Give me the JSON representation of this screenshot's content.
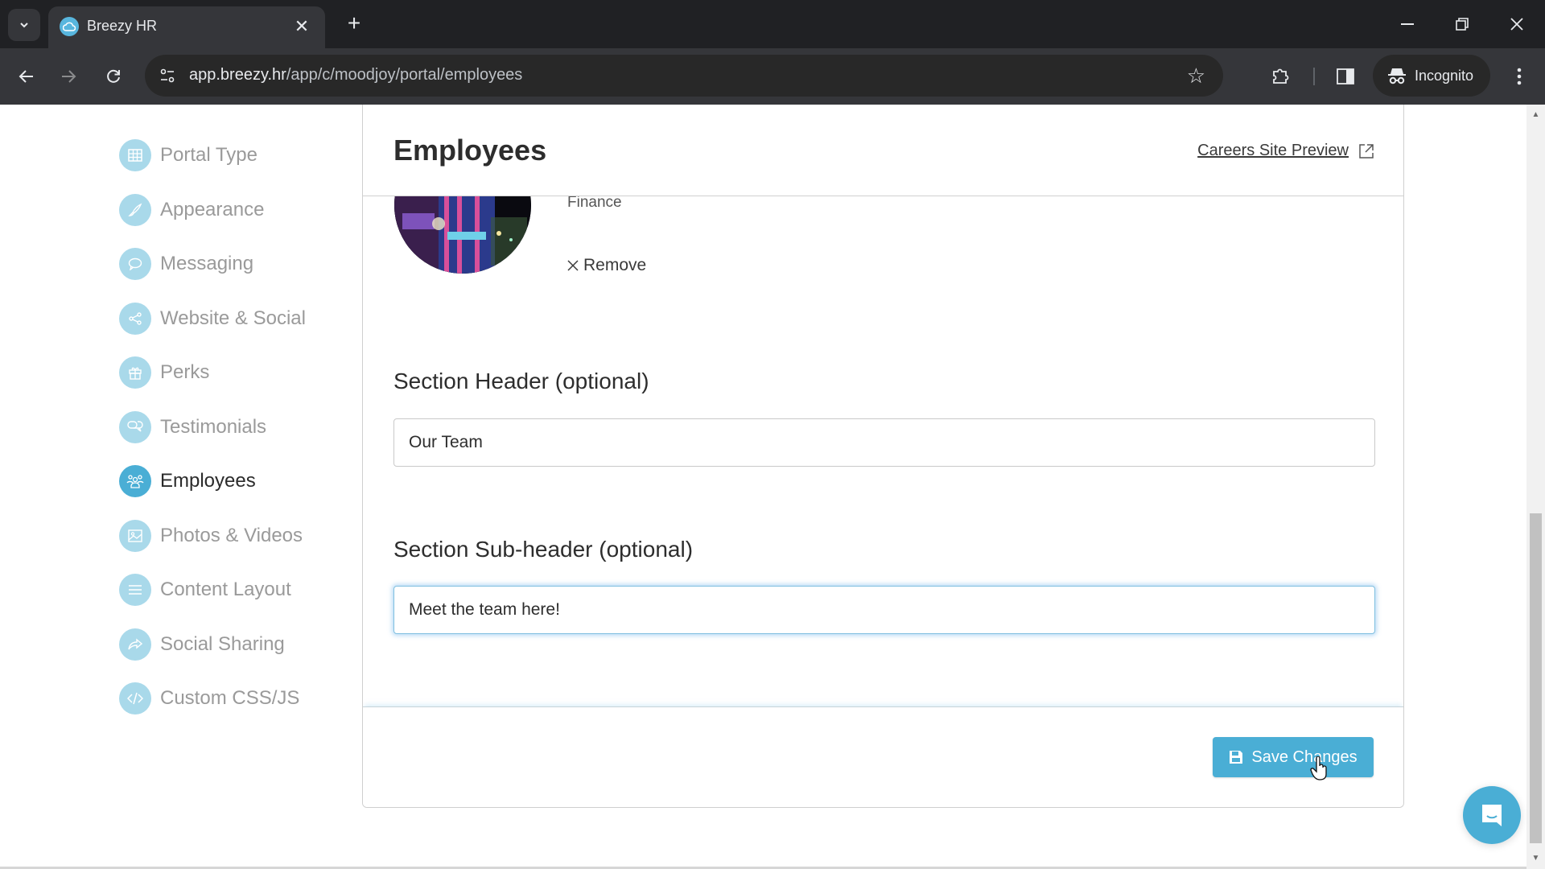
{
  "browser": {
    "tab_title": "Breezy HR",
    "url_host": "app.breezy.hr",
    "url_path": "/app/c/moodjoy/portal/employees",
    "profile_label": "Incognito"
  },
  "sidebar": {
    "items": [
      {
        "label": "Portal Type",
        "icon": "grid-icon",
        "active": false
      },
      {
        "label": "Appearance",
        "icon": "brush-icon",
        "active": false
      },
      {
        "label": "Messaging",
        "icon": "speech-bubble-icon",
        "active": false
      },
      {
        "label": "Website & Social",
        "icon": "share-icon",
        "active": false
      },
      {
        "label": "Perks",
        "icon": "gift-icon",
        "active": false
      },
      {
        "label": "Testimonials",
        "icon": "chat-bubbles-icon",
        "active": false
      },
      {
        "label": "Employees",
        "icon": "people-icon",
        "active": true
      },
      {
        "label": "Photos & Videos",
        "icon": "image-icon",
        "active": false
      },
      {
        "label": "Content Layout",
        "icon": "lines-icon",
        "active": false
      },
      {
        "label": "Social Sharing",
        "icon": "forward-share-icon",
        "active": false
      },
      {
        "label": "Custom CSS/JS",
        "icon": "code-icon",
        "active": false
      }
    ]
  },
  "panel": {
    "title": "Employees",
    "preview_link": "Careers Site Preview",
    "employee": {
      "department": "Finance",
      "remove_label": "Remove"
    },
    "section_header": {
      "label": "Section Header (optional)",
      "value": "Our Team"
    },
    "section_subheader": {
      "label": "Section Sub-header (optional)",
      "value": "Meet the team here!"
    },
    "save_label": "Save Changes"
  },
  "colors": {
    "accent": "#4aaed5",
    "accent_light": "#a9d9ea"
  }
}
